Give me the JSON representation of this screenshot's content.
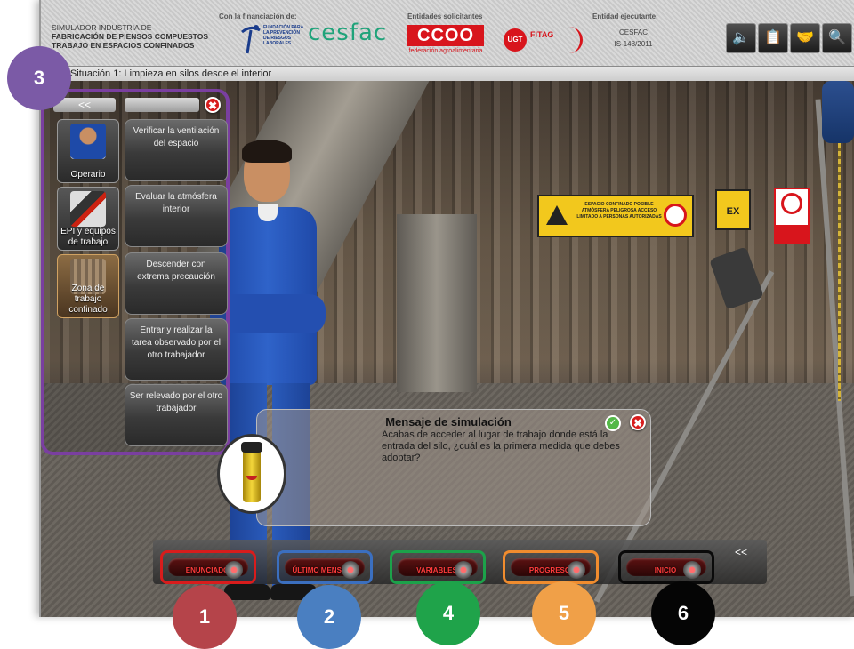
{
  "header": {
    "title_line1": "SIMULADOR INDUSTRIA DE",
    "title_line2": "FABRICACIÓN DE PIENSOS COMPUESTOS",
    "title_line3": "TRABAJO EN ESPACIOS CONFINADOS",
    "funding_label": "Con la financiación de:",
    "funding_org": "FUNDACIÓN PARA LA PREVENCIÓN DE RIESGOS LABORALES",
    "cesfac_logo": "cesfac",
    "applicants_label": "Entidades solicitantes",
    "ccoo_logo": "CCOO",
    "ccoo_sub": "federación agroalimentaria",
    "ugt_logo": "UGT",
    "fitag_logo": "FITAG",
    "executor_label": "Entidad ejecutante:",
    "executor_name": "CESFAC",
    "executor_code": "IS-148/2011",
    "toolbar": [
      {
        "name": "sound-icon",
        "glyph": "🔈"
      },
      {
        "name": "clipboard-icon",
        "glyph": "📋"
      },
      {
        "name": "handshake-icon",
        "glyph": "🤝"
      },
      {
        "name": "zoom-icon",
        "glyph": "🔍"
      }
    ]
  },
  "breadcrumb": "cio>>Situación 1: Limpieza en silos desde el interior",
  "panel": {
    "collapse_label": "<<",
    "close_icon": "✖",
    "side_buttons": [
      {
        "label": "Operario"
      },
      {
        "label": "EPI y equipos de trabajo"
      },
      {
        "label": "Zona de trabajo confinado"
      }
    ],
    "actions": [
      {
        "label": "Verificar la ventilación del espacio"
      },
      {
        "label": "Evaluar la atmósfera interior"
      },
      {
        "label": "Descender con extrema precaución"
      },
      {
        "label": "Entrar y realizar la tarea observado por el otro trabajador"
      },
      {
        "label": "Ser relevado por el otro trabajador"
      }
    ]
  },
  "scene": {
    "sign_text": "ESPACIO CONFINADO POSIBLE ATMÓSFERA PELIGROSA ACCESO LIMITADO A PERSONAS AUTORIZADAS",
    "ex_sign": "EX"
  },
  "message": {
    "title": "Mensaje de simulación",
    "text": "Acabas de acceder al lugar de trabajo donde está la entrada del silo, ¿cuál es la primera medida que debes adoptar?",
    "ok_icon": "✓",
    "close_icon": "✖"
  },
  "bottom_bar": {
    "collapse_label": "<<",
    "buttons": [
      {
        "label": "ENUNCIADO",
        "border": "#d81c1c"
      },
      {
        "label": "ÚLTIMO MENSAJE",
        "border": "#3b6fbf"
      },
      {
        "label": "VARIABLES",
        "border": "#1ca24a"
      },
      {
        "label": "PROGRESO",
        "border": "#f08c2e"
      },
      {
        "label": "INICIO",
        "border": "#0a0a0a"
      }
    ]
  },
  "markers": [
    {
      "number": "3",
      "color": "#7b5aa6"
    },
    {
      "number": "1",
      "color": "#b5444a"
    },
    {
      "number": "2",
      "color": "#4a7fc1"
    },
    {
      "number": "4",
      "color": "#1fa34a"
    },
    {
      "number": "5",
      "color": "#f0a048"
    },
    {
      "number": "6",
      "color": "#050505"
    }
  ]
}
